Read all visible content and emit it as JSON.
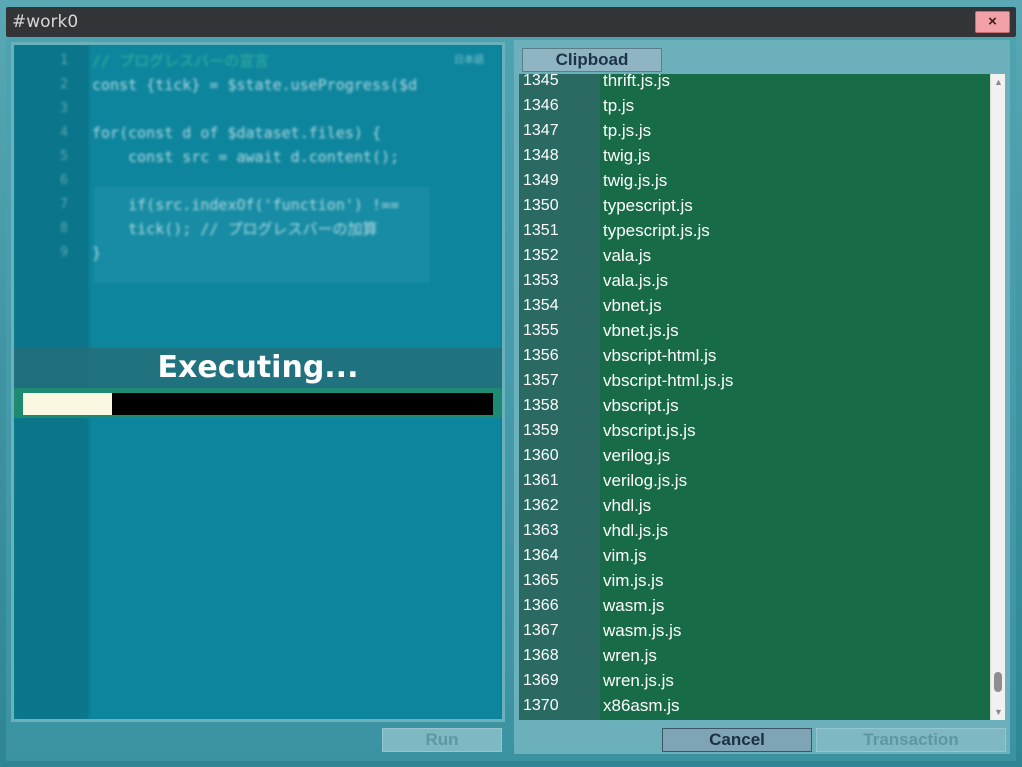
{
  "window": {
    "title": "#work0",
    "close_label": "×"
  },
  "editor": {
    "tag": "日本語",
    "lines": [
      {
        "n": "1",
        "text": "// プログレスバーの宣言"
      },
      {
        "n": "2",
        "text": "const {tick} = $state.useProgress($d"
      },
      {
        "n": "3",
        "text": ""
      },
      {
        "n": "4",
        "text": "for(const d of $dataset.files) {"
      },
      {
        "n": "5",
        "text": "    const src = await d.content();"
      },
      {
        "n": "6",
        "text": ""
      },
      {
        "n": "7",
        "text": "    if(src.indexOf('function') !=="
      },
      {
        "n": "8",
        "text": "    tick(); // プログレスバーの加算"
      },
      {
        "n": "9",
        "text": "}"
      }
    ]
  },
  "status": {
    "text": "Executing...",
    "progress": 0.19
  },
  "left_footer": {
    "run_label": "Run"
  },
  "right_panel": {
    "clipboard_label": "Clipboad",
    "rows": [
      {
        "num": "1345",
        "name": "thrift.js.js"
      },
      {
        "num": "1346",
        "name": "tp.js"
      },
      {
        "num": "1347",
        "name": "tp.js.js"
      },
      {
        "num": "1348",
        "name": "twig.js"
      },
      {
        "num": "1349",
        "name": "twig.js.js"
      },
      {
        "num": "1350",
        "name": "typescript.js"
      },
      {
        "num": "1351",
        "name": "typescript.js.js"
      },
      {
        "num": "1352",
        "name": "vala.js"
      },
      {
        "num": "1353",
        "name": "vala.js.js"
      },
      {
        "num": "1354",
        "name": "vbnet.js"
      },
      {
        "num": "1355",
        "name": "vbnet.js.js"
      },
      {
        "num": "1356",
        "name": "vbscript-html.js"
      },
      {
        "num": "1357",
        "name": "vbscript-html.js.js"
      },
      {
        "num": "1358",
        "name": "vbscript.js"
      },
      {
        "num": "1359",
        "name": "vbscript.js.js"
      },
      {
        "num": "1360",
        "name": "verilog.js"
      },
      {
        "num": "1361",
        "name": "verilog.js.js"
      },
      {
        "num": "1362",
        "name": "vhdl.js"
      },
      {
        "num": "1363",
        "name": "vhdl.js.js"
      },
      {
        "num": "1364",
        "name": "vim.js"
      },
      {
        "num": "1365",
        "name": "vim.js.js"
      },
      {
        "num": "1366",
        "name": "wasm.js"
      },
      {
        "num": "1367",
        "name": "wasm.js.js"
      },
      {
        "num": "1368",
        "name": "wren.js"
      },
      {
        "num": "1369",
        "name": "wren.js.js"
      },
      {
        "num": "1370",
        "name": "x86asm.js"
      }
    ],
    "scroll_position": 0.98,
    "cancel_label": "Cancel",
    "transaction_label": "Transaction"
  },
  "colors": {
    "list_bg": "#176b47",
    "progress_fill": "#fbf8e2",
    "close_button": "#f2a1a8"
  }
}
